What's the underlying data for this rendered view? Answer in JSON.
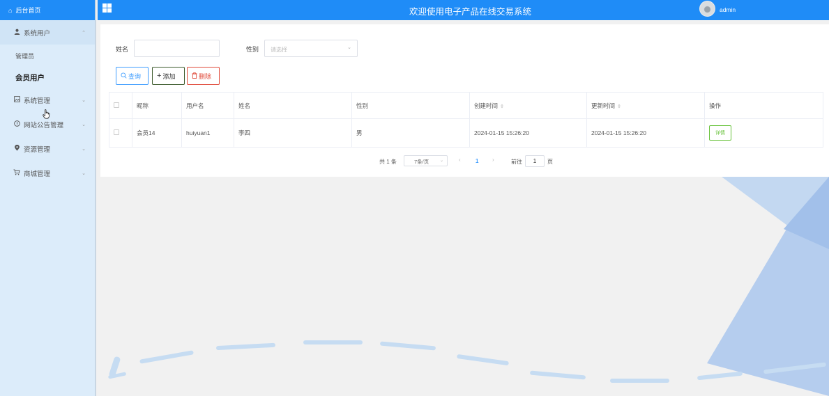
{
  "sidebar": {
    "home": {
      "icon": "home-icon",
      "label": "后台首页"
    },
    "groups": [
      {
        "icon": "user-icon",
        "label": "系统用户",
        "expanded": true,
        "children": [
          "管理员",
          "会员用户"
        ],
        "active_child": "会员用户"
      },
      {
        "icon": "image-icon",
        "label": "系统管理"
      },
      {
        "icon": "info-circle-icon",
        "label": "网站公告管理"
      },
      {
        "icon": "location-icon",
        "label": "资源管理"
      },
      {
        "icon": "cart-icon",
        "label": "商城管理"
      }
    ]
  },
  "topbar": {
    "title": "欢迎使用电子产品在线交易系统",
    "username": "admin"
  },
  "filters": {
    "name_label": "姓名",
    "name_value": "",
    "gender_label": "性别",
    "gender_placeholder": "请选择"
  },
  "actions": {
    "search": "查询",
    "add": "添加",
    "delete": "删除"
  },
  "table": {
    "columns": [
      "昵称",
      "用户名",
      "姓名",
      "性别",
      "创建时间",
      "更新时间",
      "操作"
    ],
    "rows": [
      {
        "nickname": "会员14",
        "username": "huiyuan1",
        "name": "李四",
        "gender": "男",
        "created": "2024-01-15 15:26:20",
        "updated": "2024-01-15 15:26:20",
        "action": "详情"
      }
    ]
  },
  "pagination": {
    "total_text": "共 1 条",
    "page_size": "7条/页",
    "current_page": "1",
    "goto_label": "前往",
    "goto_value": "1",
    "page_suffix": "页"
  },
  "colors": {
    "primary": "#1f8cf7",
    "sidebar_bg": "#dcecfa",
    "success": "#67c23a",
    "danger": "#e04a3a"
  }
}
